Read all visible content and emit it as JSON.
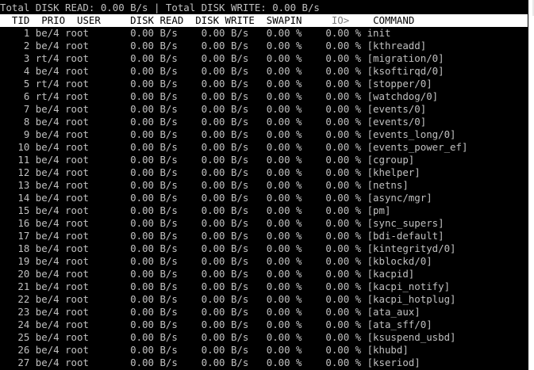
{
  "colors": {
    "background": "#000000",
    "foreground": "#c0c0c0",
    "header_background": "#ffffff",
    "header_foreground": "#000000"
  },
  "summary": {
    "total_disk_read_label": "Total DISK READ:",
    "total_disk_read_value": "0.00 B/s",
    "separator": "|",
    "total_disk_write_label": "Total DISK WRITE:",
    "total_disk_write_value": "0.00 B/s"
  },
  "columns": {
    "tid": "TID",
    "prio": "PRIO",
    "user": "USER",
    "disk_read": "DISK READ",
    "disk_write": "DISK WRITE",
    "swapin": "SWAPIN",
    "io": "IO>",
    "command": "COMMAND"
  },
  "rows": [
    {
      "tid": "1",
      "prio": "be/4",
      "user": "root",
      "read": "0.00 B/s",
      "write": "0.00 B/s",
      "swapin": "0.00 %",
      "io": "0.00 %",
      "command": "init"
    },
    {
      "tid": "2",
      "prio": "be/4",
      "user": "root",
      "read": "0.00 B/s",
      "write": "0.00 B/s",
      "swapin": "0.00 %",
      "io": "0.00 %",
      "command": "[kthreadd]"
    },
    {
      "tid": "3",
      "prio": "rt/4",
      "user": "root",
      "read": "0.00 B/s",
      "write": "0.00 B/s",
      "swapin": "0.00 %",
      "io": "0.00 %",
      "command": "[migration/0]"
    },
    {
      "tid": "4",
      "prio": "be/4",
      "user": "root",
      "read": "0.00 B/s",
      "write": "0.00 B/s",
      "swapin": "0.00 %",
      "io": "0.00 %",
      "command": "[ksoftirqd/0]"
    },
    {
      "tid": "5",
      "prio": "rt/4",
      "user": "root",
      "read": "0.00 B/s",
      "write": "0.00 B/s",
      "swapin": "0.00 %",
      "io": "0.00 %",
      "command": "[stopper/0]"
    },
    {
      "tid": "6",
      "prio": "rt/4",
      "user": "root",
      "read": "0.00 B/s",
      "write": "0.00 B/s",
      "swapin": "0.00 %",
      "io": "0.00 %",
      "command": "[watchdog/0]"
    },
    {
      "tid": "7",
      "prio": "be/4",
      "user": "root",
      "read": "0.00 B/s",
      "write": "0.00 B/s",
      "swapin": "0.00 %",
      "io": "0.00 %",
      "command": "[events/0]"
    },
    {
      "tid": "8",
      "prio": "be/4",
      "user": "root",
      "read": "0.00 B/s",
      "write": "0.00 B/s",
      "swapin": "0.00 %",
      "io": "0.00 %",
      "command": "[events/0]"
    },
    {
      "tid": "9",
      "prio": "be/4",
      "user": "root",
      "read": "0.00 B/s",
      "write": "0.00 B/s",
      "swapin": "0.00 %",
      "io": "0.00 %",
      "command": "[events_long/0]"
    },
    {
      "tid": "10",
      "prio": "be/4",
      "user": "root",
      "read": "0.00 B/s",
      "write": "0.00 B/s",
      "swapin": "0.00 %",
      "io": "0.00 %",
      "command": "[events_power_ef]"
    },
    {
      "tid": "11",
      "prio": "be/4",
      "user": "root",
      "read": "0.00 B/s",
      "write": "0.00 B/s",
      "swapin": "0.00 %",
      "io": "0.00 %",
      "command": "[cgroup]"
    },
    {
      "tid": "12",
      "prio": "be/4",
      "user": "root",
      "read": "0.00 B/s",
      "write": "0.00 B/s",
      "swapin": "0.00 %",
      "io": "0.00 %",
      "command": "[khelper]"
    },
    {
      "tid": "13",
      "prio": "be/4",
      "user": "root",
      "read": "0.00 B/s",
      "write": "0.00 B/s",
      "swapin": "0.00 %",
      "io": "0.00 %",
      "command": "[netns]"
    },
    {
      "tid": "14",
      "prio": "be/4",
      "user": "root",
      "read": "0.00 B/s",
      "write": "0.00 B/s",
      "swapin": "0.00 %",
      "io": "0.00 %",
      "command": "[async/mgr]"
    },
    {
      "tid": "15",
      "prio": "be/4",
      "user": "root",
      "read": "0.00 B/s",
      "write": "0.00 B/s",
      "swapin": "0.00 %",
      "io": "0.00 %",
      "command": "[pm]"
    },
    {
      "tid": "16",
      "prio": "be/4",
      "user": "root",
      "read": "0.00 B/s",
      "write": "0.00 B/s",
      "swapin": "0.00 %",
      "io": "0.00 %",
      "command": "[sync_supers]"
    },
    {
      "tid": "17",
      "prio": "be/4",
      "user": "root",
      "read": "0.00 B/s",
      "write": "0.00 B/s",
      "swapin": "0.00 %",
      "io": "0.00 %",
      "command": "[bdi-default]"
    },
    {
      "tid": "18",
      "prio": "be/4",
      "user": "root",
      "read": "0.00 B/s",
      "write": "0.00 B/s",
      "swapin": "0.00 %",
      "io": "0.00 %",
      "command": "[kintegrityd/0]"
    },
    {
      "tid": "19",
      "prio": "be/4",
      "user": "root",
      "read": "0.00 B/s",
      "write": "0.00 B/s",
      "swapin": "0.00 %",
      "io": "0.00 %",
      "command": "[kblockd/0]"
    },
    {
      "tid": "20",
      "prio": "be/4",
      "user": "root",
      "read": "0.00 B/s",
      "write": "0.00 B/s",
      "swapin": "0.00 %",
      "io": "0.00 %",
      "command": "[kacpid]"
    },
    {
      "tid": "21",
      "prio": "be/4",
      "user": "root",
      "read": "0.00 B/s",
      "write": "0.00 B/s",
      "swapin": "0.00 %",
      "io": "0.00 %",
      "command": "[kacpi_notify]"
    },
    {
      "tid": "22",
      "prio": "be/4",
      "user": "root",
      "read": "0.00 B/s",
      "write": "0.00 B/s",
      "swapin": "0.00 %",
      "io": "0.00 %",
      "command": "[kacpi_hotplug]"
    },
    {
      "tid": "23",
      "prio": "be/4",
      "user": "root",
      "read": "0.00 B/s",
      "write": "0.00 B/s",
      "swapin": "0.00 %",
      "io": "0.00 %",
      "command": "[ata_aux]"
    },
    {
      "tid": "24",
      "prio": "be/4",
      "user": "root",
      "read": "0.00 B/s",
      "write": "0.00 B/s",
      "swapin": "0.00 %",
      "io": "0.00 %",
      "command": "[ata_sff/0]"
    },
    {
      "tid": "25",
      "prio": "be/4",
      "user": "root",
      "read": "0.00 B/s",
      "write": "0.00 B/s",
      "swapin": "0.00 %",
      "io": "0.00 %",
      "command": "[ksuspend_usbd]"
    },
    {
      "tid": "26",
      "prio": "be/4",
      "user": "root",
      "read": "0.00 B/s",
      "write": "0.00 B/s",
      "swapin": "0.00 %",
      "io": "0.00 %",
      "command": "[khubd]"
    },
    {
      "tid": "27",
      "prio": "be/4",
      "user": "root",
      "read": "0.00 B/s",
      "write": "0.00 B/s",
      "swapin": "0.00 %",
      "io": "0.00 %",
      "command": "[kseriod]"
    }
  ]
}
